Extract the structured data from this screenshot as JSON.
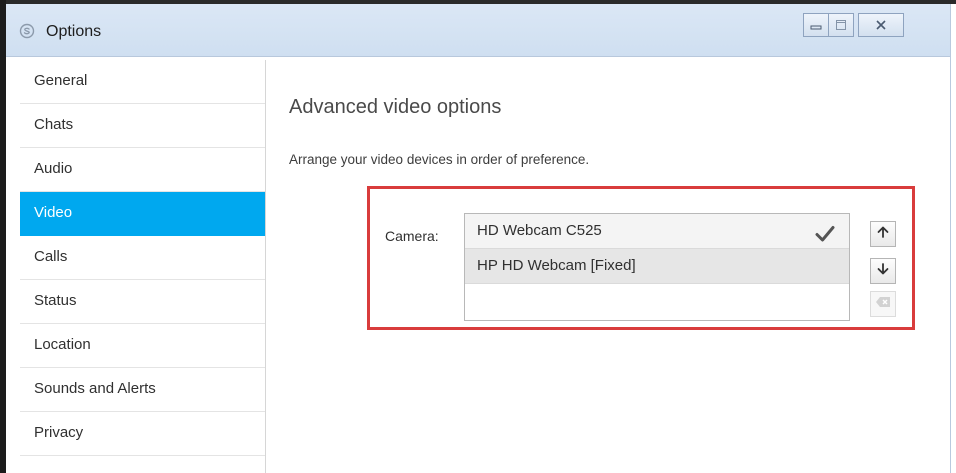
{
  "window": {
    "title": "Options"
  },
  "sidebar": {
    "items": [
      {
        "label": "General"
      },
      {
        "label": "Chats"
      },
      {
        "label": "Audio"
      },
      {
        "label": "Video"
      },
      {
        "label": "Calls"
      },
      {
        "label": "Status"
      },
      {
        "label": "Location"
      },
      {
        "label": "Sounds and Alerts"
      },
      {
        "label": "Privacy"
      }
    ],
    "selected": "Video"
  },
  "main": {
    "heading": "Advanced video options",
    "description": "Arrange your video devices in order of preference.",
    "camera_label": "Camera:",
    "devices": [
      {
        "name": "HD Webcam C525",
        "selected": true
      },
      {
        "name": "HP HD Webcam [Fixed]",
        "selected": false
      }
    ]
  },
  "icons": {
    "app": "skype-icon",
    "minimize": "minimize-icon",
    "maximize": "maximize-icon",
    "close": "close-icon",
    "check": "checkmark-icon",
    "move_up": "arrow-up-icon",
    "move_down": "arrow-down-icon",
    "remove": "delete-icon"
  },
  "colors": {
    "selection": "#00a8ef",
    "highlight_frame": "#d93c3c",
    "titlebar": "#d6e4f4"
  }
}
